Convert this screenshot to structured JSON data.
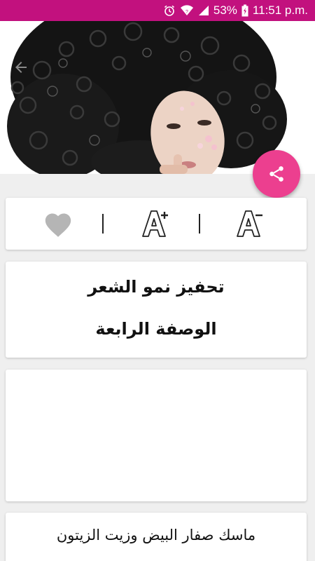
{
  "status_bar": {
    "battery": "53%",
    "time": "11:51 p.m.",
    "color": "#c2117e"
  },
  "hero": {
    "image": "woman-with-curly-black-hair"
  },
  "fab": {
    "icon": "share-icon",
    "color": "#ec3f8f"
  },
  "actions": {
    "favorite_icon": "heart-icon",
    "increase_font_icon": "font-increase-icon",
    "decrease_font_icon": "font-decrease-icon"
  },
  "article": {
    "title": "تحفيز نمو الشعر",
    "subtitle": "الوصفة الرابعة",
    "section_heading": "ماسك صفار البيض وزيت الزيتون"
  }
}
